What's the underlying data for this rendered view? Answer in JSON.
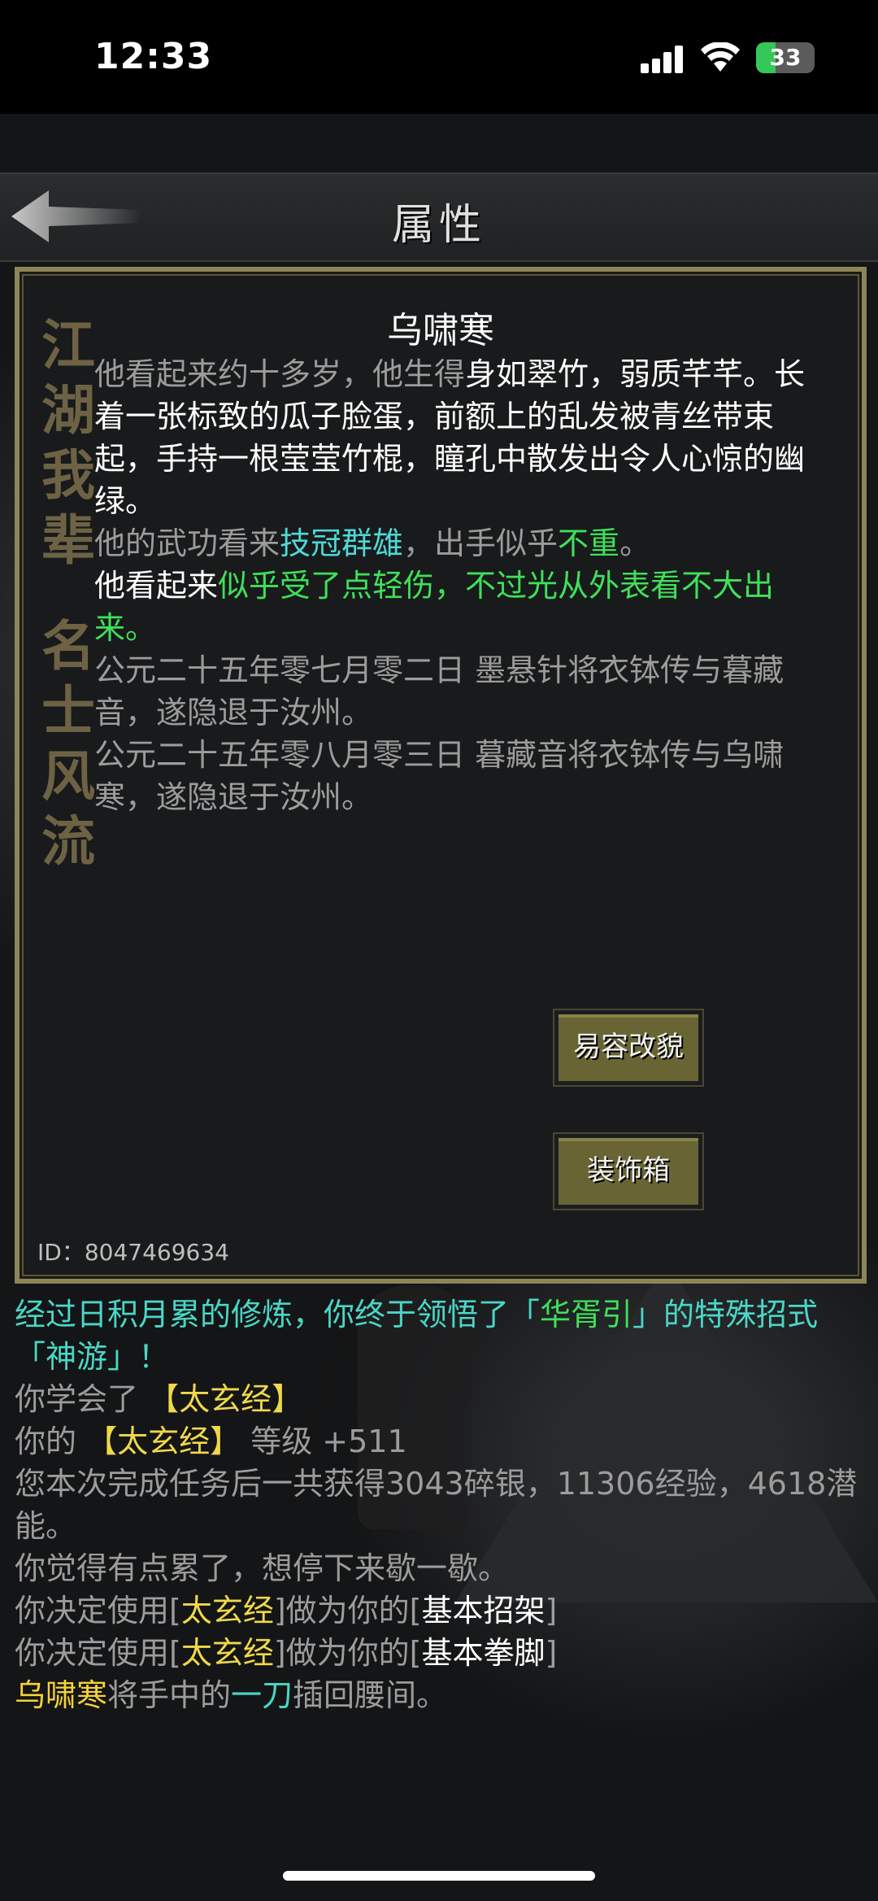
{
  "status": {
    "time": "12:33",
    "battery": "33",
    "battery_level_percent": 33
  },
  "header": {
    "title": "属性",
    "back_icon": "back-arrow-icon"
  },
  "panel": {
    "side_slogan_top": [
      "江",
      "湖",
      "我",
      "辈"
    ],
    "side_slogan_bottom": [
      "名",
      "士",
      "风",
      "流"
    ],
    "name": "乌啸寒",
    "desc1_a": "他看起来约十多岁，他生得",
    "desc1_b": "身如翠竹，弱质芊芊。长着一张标致的瓜子脸蛋，前额上的乱发被青丝带束起，手持一根莹莹竹棍，瞳孔中散发出令人心惊的幽绿。",
    "desc2_a": "他的武功看来",
    "desc2_b": "技冠群雄",
    "desc2_c": "，出手似乎",
    "desc2_d": "不重",
    "desc2_e": "。",
    "desc3_a": "他看起来",
    "desc3_b": "似乎受了点轻伤，不过光从外表看不大出来。",
    "history1": "公元二十五年零七月零二日 墨悬针将衣钵传与暮藏音，遂隐退于汝州。",
    "history2": "公元二十五年零八月零三日 暮藏音将衣钵传与乌啸寒，遂隐退于汝州。",
    "button_disguise": "易容改貌",
    "button_wardrobe": "装饰箱",
    "id_text": "ID：8047469634"
  },
  "log": {
    "l1_a": "经过日积月累的修炼，你终于领悟了「",
    "l1_b": "华胥引",
    "l1_c": "」的特殊招式「神游」！",
    "l2_a": "你学会了 ",
    "l2_b": "【太玄经】",
    "l3_a": "你的 ",
    "l3_b": "【太玄经】",
    "l3_c": " 等级 +511",
    "l4": "您本次完成任务后一共获得3043碎银，11306经验，4618潜能。",
    "l5": "你觉得有点累了，想停下来歇一歇。",
    "l6_a": "你决定使用[",
    "l6_b": "太玄经",
    "l6_c": "]做为你的[",
    "l6_d": "基本招架",
    "l6_e": "]",
    "l7_a": "你决定使用[",
    "l7_b": "太玄经",
    "l7_c": "]做为你的[",
    "l7_d": "基本拳脚",
    "l7_e": "]",
    "l8_a": "乌啸寒",
    "l8_b": "将手中的",
    "l8_c": "一刀",
    "l8_d": "插回腰间。"
  }
}
